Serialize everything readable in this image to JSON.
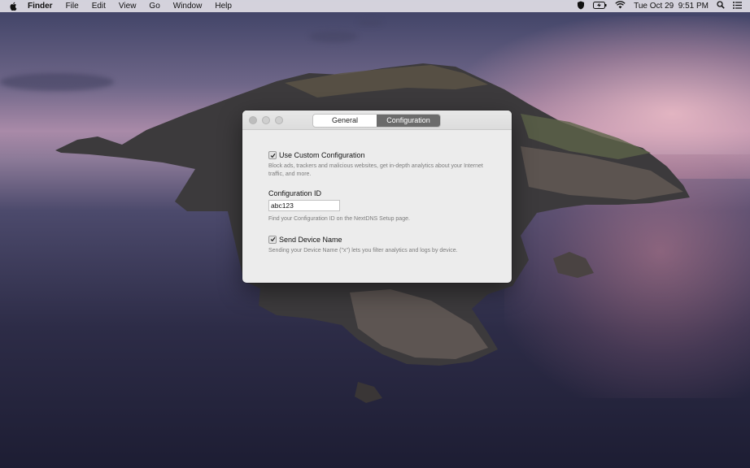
{
  "menubar": {
    "app_name": "Finder",
    "menus": [
      "File",
      "Edit",
      "View",
      "Go",
      "Window",
      "Help"
    ],
    "clock": "Tue Oct 29  9:51 PM",
    "status_icons": [
      "shield-icon",
      "battery-charging-icon",
      "wifi-icon",
      "spotlight-search-icon",
      "notification-center-icon"
    ]
  },
  "window": {
    "tabs": [
      {
        "label": "General",
        "selected": false
      },
      {
        "label": "Configuration",
        "selected": true
      }
    ],
    "use_custom_config": {
      "label": "Use Custom Configuration",
      "checked": true,
      "description": "Block ads, trackers and malicious websites, get in-depth analytics about your Internet traffic, and more."
    },
    "configuration_id": {
      "label": "Configuration ID",
      "value": "abc123",
      "help": "Find your Configuration ID on the NextDNS Setup page."
    },
    "send_device_name": {
      "label": "Send Device Name",
      "checked": true,
      "description": "Sending your Device Name (\"x\") lets you filter analytics and logs by device."
    }
  },
  "colors": {
    "selected_tab": "#6b6b6b",
    "window_bg": "#ececec"
  }
}
